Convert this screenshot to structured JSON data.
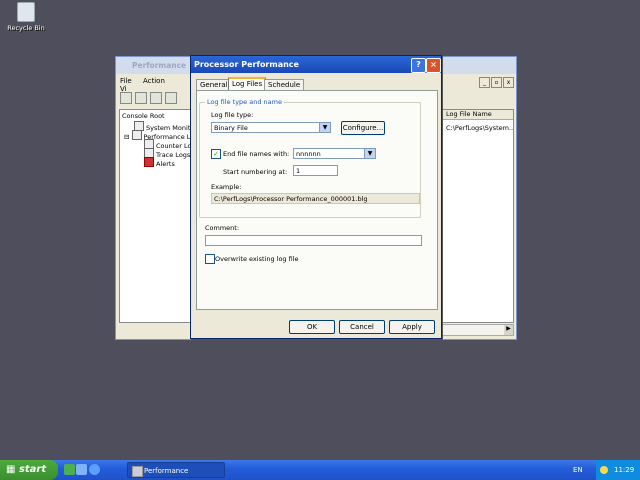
{
  "desktop": {
    "recycle_bin": "Recycle Bin"
  },
  "mmc": {
    "title": "Performance",
    "menu": [
      "File",
      "Action",
      "Vi"
    ],
    "tree": [
      "Console Root",
      "System Monitor",
      "Performance Lo",
      "Counter Lo",
      "Trace Logs",
      "Alerts"
    ],
    "right_header": "Log File Name",
    "right_cell": "C:\\PerfLogs\\System..."
  },
  "dialog": {
    "title": "Processor Performance",
    "tabs": [
      "General",
      "Log Files",
      "Schedule"
    ],
    "group_label": "Log file type and name",
    "log_file_type_label": "Log file type:",
    "log_file_type_value": "Binary File",
    "configure_button": "Configure...",
    "end_names_label": "End file names with:",
    "end_names_value": "nnnnnn",
    "start_numbering_label": "Start numbering at:",
    "start_numbering_value": "1",
    "example_label": "Example:",
    "example_value": "C:\\PerfLogs\\Processor Performance_000001.blg",
    "comment_label": "Comment:",
    "comment_value": "",
    "overwrite_label": "Overwrite existing log file",
    "end_names_checked": true,
    "overwrite_checked": false,
    "ok_button": "OK",
    "cancel_button": "Cancel",
    "apply_button": "Apply"
  },
  "taskbar": {
    "start_label": "start",
    "task_label": "Performance",
    "language": "EN",
    "time": "11:29"
  }
}
